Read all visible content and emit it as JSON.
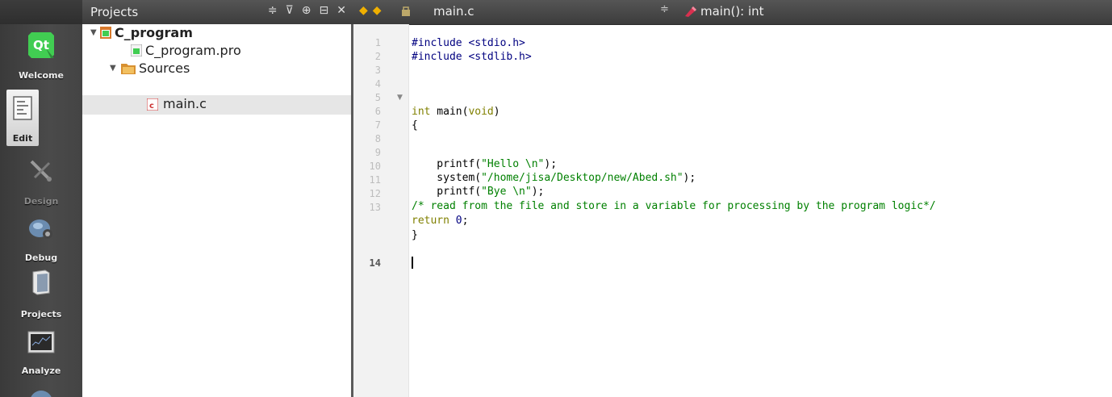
{
  "modes": [
    {
      "label": "Welcome",
      "icon": "qt-logo-icon",
      "state": "normal"
    },
    {
      "label": "Edit",
      "icon": "edit-document-icon",
      "state": "active"
    },
    {
      "label": "Design",
      "icon": "design-tools-icon",
      "state": "disabled"
    },
    {
      "label": "Debug",
      "icon": "debug-bug-icon",
      "state": "normal"
    },
    {
      "label": "Projects",
      "icon": "projects-folder-icon",
      "state": "normal"
    },
    {
      "label": "Analyze",
      "icon": "analyze-monitor-icon",
      "state": "normal"
    }
  ],
  "projects_panel": {
    "title": "Projects",
    "dropdown_glyph": "≑",
    "filter_glyph": "⊽",
    "sync_glyph": "⊕",
    "split_glyph": "⊟",
    "close_glyph": "✕"
  },
  "tree": [
    {
      "label": "C_program",
      "level": 0,
      "expanded": true,
      "icon": "project-icon",
      "bold": true,
      "selected": false
    },
    {
      "label": "C_program.pro",
      "level": 1,
      "expanded": null,
      "icon": "pro-file-icon",
      "bold": false,
      "selected": false
    },
    {
      "label": "Sources",
      "level": 1,
      "expanded": true,
      "icon": "sources-folder-icon",
      "bold": false,
      "selected": false
    },
    {
      "label": "main.c",
      "level": 2,
      "expanded": null,
      "icon": "c-file-icon",
      "bold": false,
      "selected": true
    }
  ],
  "editor_toolbar": {
    "back_glyph": "◆",
    "forward_glyph": "◆",
    "file_name": "main.c",
    "file_dropdown_glyph": "≑",
    "symbol": "main(): int"
  },
  "editor": {
    "current_line": 14,
    "lines": [
      {
        "n": "1",
        "text": "#include <stdio.h>"
      },
      {
        "n": "2",
        "text": "#include <stdlib.h>"
      },
      {
        "n": "3",
        "text": ""
      },
      {
        "n": "4",
        "text": ""
      },
      {
        "n": "5",
        "text": "int main(void)",
        "fold": "▼"
      },
      {
        "n": "6",
        "text": "{"
      },
      {
        "n": "7",
        "text": ""
      },
      {
        "n": "8",
        "text": "    printf(\"Hello \\n\");"
      },
      {
        "n": "9",
        "text": "    system(\"/home/jisa/Desktop/new/Abed.sh\");"
      },
      {
        "n": "10",
        "text": "    printf(\"Bye \\n\");"
      },
      {
        "n": "11",
        "text": "/* read from the file and store in a variable for processing by the program logic*/"
      },
      {
        "n": "12",
        "text": "return 0;"
      },
      {
        "n": "13",
        "text": "}"
      },
      {
        "n": "14",
        "text": ""
      }
    ]
  }
}
